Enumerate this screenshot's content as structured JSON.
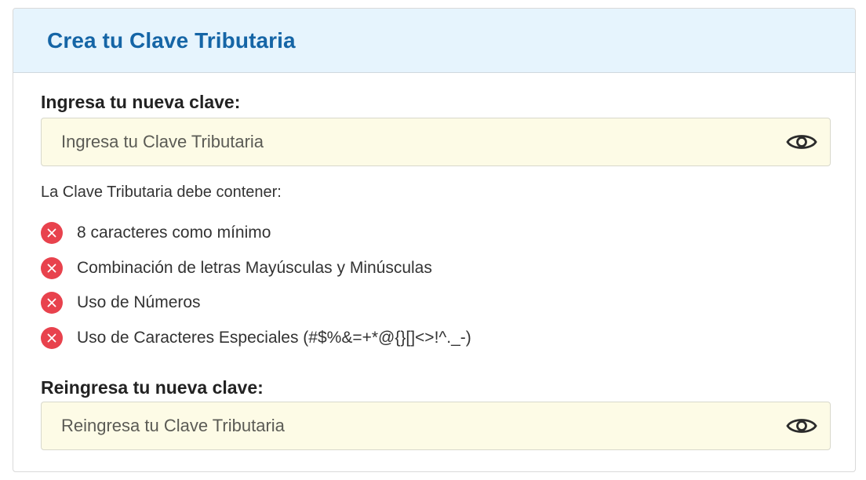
{
  "card": {
    "title": "Crea tu Clave Tributaria"
  },
  "new_password": {
    "label": "Ingresa tu nueva clave:",
    "placeholder": "Ingresa tu Clave Tributaria",
    "value": "",
    "toggle_icon": "eye-icon"
  },
  "requirements": {
    "intro": "La Clave Tributaria debe contener:",
    "status_icon": "x-circle-icon",
    "status_color": "#e8424d",
    "items": [
      {
        "text": "8 caracteres como mínimo",
        "met": false
      },
      {
        "text": "Combinación de letras Mayúsculas y Minúsculas",
        "met": false
      },
      {
        "text": "Uso de Números",
        "met": false
      },
      {
        "text": "Uso de Caracteres Especiales (#$%&=+*@{}[]<>!^._-)",
        "met": false
      }
    ]
  },
  "confirm_password": {
    "label": "Reingresa tu nueva clave:",
    "placeholder": "Reingresa tu Clave Tributaria",
    "value": "",
    "toggle_icon": "eye-icon"
  },
  "colors": {
    "title": "#1565a6",
    "header_bg": "#e6f4fd",
    "input_bg": "#fdfbe6",
    "error": "#e8424d"
  }
}
